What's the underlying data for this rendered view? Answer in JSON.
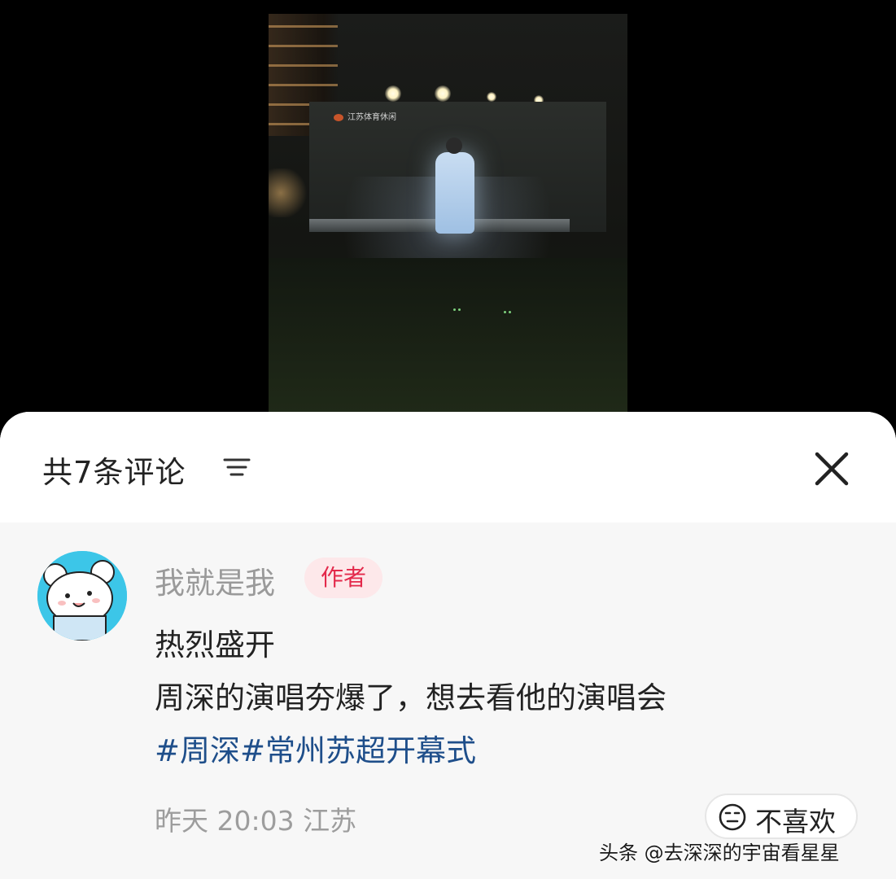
{
  "video": {
    "screen_logo_text": "江苏体育休闲"
  },
  "comments_panel": {
    "title": "共7条评论",
    "filter_icon": "filter-lines-icon",
    "close_icon": "close-x-icon"
  },
  "comment": {
    "author_name": "我就是我",
    "author_badge": "作者",
    "lines": [
      "热烈盛开",
      "周深的演唱夯爆了，想去看他的演唱会"
    ],
    "hashtags": [
      "#周深",
      "#常州苏超开幕式"
    ],
    "time_location": "昨天 20:03 江苏",
    "dislike_label": "不喜欢",
    "colors": {
      "badge_text": "#e3294b",
      "badge_bg": "#fde8ea",
      "hashtag": "#1e4e8a"
    }
  },
  "watermark": "头条 @去深深的宇宙看星星"
}
